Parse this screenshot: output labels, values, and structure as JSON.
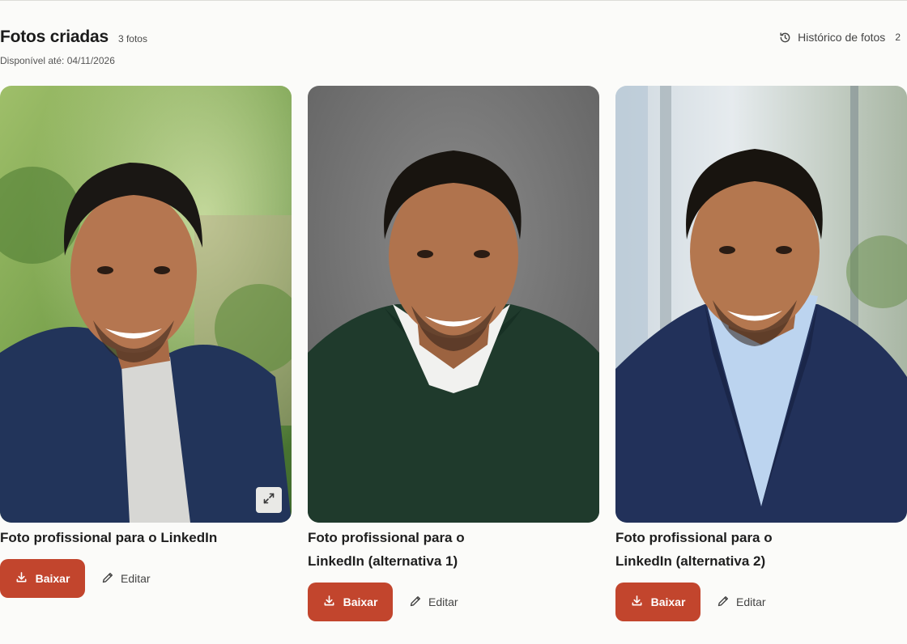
{
  "header": {
    "title": "Fotos criadas",
    "count": "3 fotos",
    "availability": "Disponível até: 04/11/2026",
    "history_label": "Histórico de fotos",
    "history_count": "2"
  },
  "photos": [
    {
      "caption_lines": [
        "Foto profissional para o LinkedIn"
      ],
      "download_label": "Baixar",
      "edit_label": "Editar",
      "icon": "expand-icon"
    },
    {
      "caption_lines": [
        "Foto profissional para o",
        "LinkedIn (alternativa 1)"
      ],
      "download_label": "Baixar",
      "edit_label": "Editar"
    },
    {
      "caption_lines": [
        "Foto profissional para o",
        "LinkedIn (alternativa 2)"
      ],
      "download_label": "Baixar",
      "edit_label": "Editar"
    }
  ],
  "colors": {
    "accent": "#c2452d",
    "background": "#fbfbf9"
  }
}
